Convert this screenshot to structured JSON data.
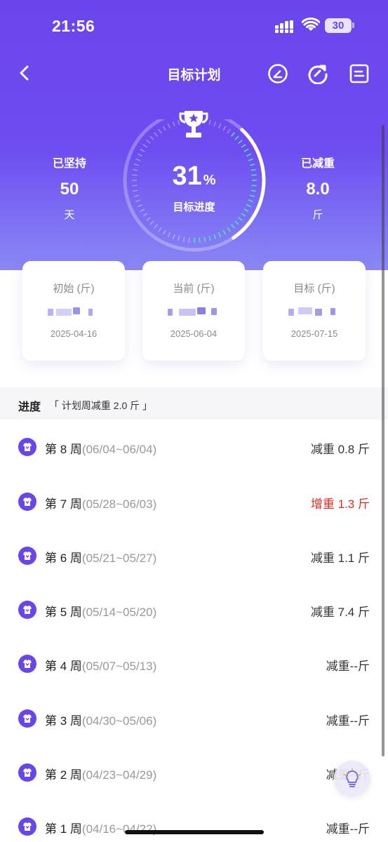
{
  "status": {
    "time": "21:56",
    "battery": "30"
  },
  "nav": {
    "title": "目标计划"
  },
  "stats": {
    "persisted": {
      "label": "已坚持",
      "value": "50",
      "unit": "天"
    },
    "lost": {
      "label": "已减重",
      "value": "8.0",
      "unit": "斤"
    }
  },
  "goal_ring": {
    "percent": "31",
    "percent_sign": "%",
    "label": "目标进度",
    "progress_fraction": 0.31
  },
  "cards": [
    {
      "label": "初始 (斤)",
      "date": "2025-04-16"
    },
    {
      "label": "当前 (斤)",
      "date": "2025-06-04"
    },
    {
      "label": "目标 (斤)",
      "date": "2025-07-15"
    }
  ],
  "progress": {
    "title": "进度",
    "subtitle": "「 计划周减重 2.0 斤 」"
  },
  "weeks": [
    {
      "name": "第 8 周",
      "range": "(06/04~06/04)",
      "change": "减重 0.8 斤",
      "gain": false
    },
    {
      "name": "第 7 周",
      "range": "(05/28~06/03)",
      "change": "增重 1.3 斤",
      "gain": true
    },
    {
      "name": "第 6 周",
      "range": "(05/21~05/27)",
      "change": "减重 1.1 斤",
      "gain": false
    },
    {
      "name": "第 5 周",
      "range": "(05/14~05/20)",
      "change": "减重 7.4 斤",
      "gain": false
    },
    {
      "name": "第 4 周",
      "range": "(05/07~05/13)",
      "change": "减重--斤",
      "gain": false
    },
    {
      "name": "第 3 周",
      "range": "(04/30~05/06)",
      "change": "减重--斤",
      "gain": false
    },
    {
      "name": "第 2 周",
      "range": "(04/23~04/29)",
      "change": "减重--斤",
      "gain": false
    },
    {
      "name": "第 1 周",
      "range": "(04/16~04/22)",
      "change": "减重--斤",
      "gain": false
    }
  ],
  "colors": {
    "primary": "#6a45ec",
    "gain": "#e2291f",
    "ring_accent": "#4fe0c8"
  },
  "icons": [
    "back-icon",
    "edit-icon",
    "refresh-icon",
    "list-icon",
    "trophy-icon",
    "week-badge-icon",
    "lightbulb-icon"
  ]
}
